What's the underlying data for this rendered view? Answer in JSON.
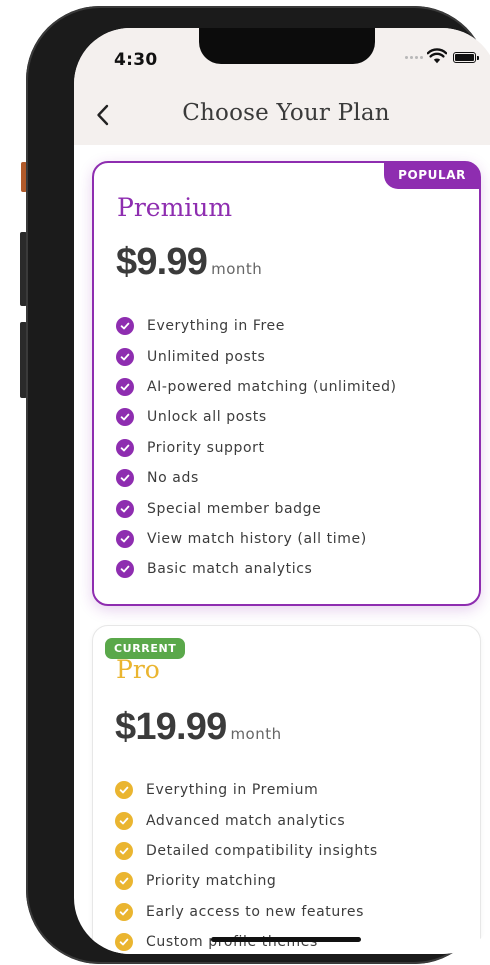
{
  "status_bar": {
    "time": "4:30"
  },
  "header": {
    "title": "Choose Your Plan"
  },
  "plans": [
    {
      "badge": "POPULAR",
      "name": "Premium",
      "price": "$9.99",
      "period": "month",
      "accent_color": "#8e2db0",
      "features": [
        "Everything in Free",
        "Unlimited posts",
        "AI-powered matching (unlimited)",
        "Unlock all posts",
        "Priority support",
        "No ads",
        "Special member badge",
        "View match history (all time)",
        "Basic match analytics"
      ]
    },
    {
      "badge": "CURRENT",
      "name": "Pro",
      "price": "$19.99",
      "period": "month",
      "accent_color": "#eab530",
      "badge_color": "#5aa84a",
      "features": [
        "Everything in Premium",
        "Advanced match analytics",
        "Detailed compatibility insights",
        "Priority matching",
        "Early access to new features",
        "Custom profile themes"
      ]
    }
  ],
  "icons": {
    "back": "chevron-left-icon",
    "check": "check-circle-icon",
    "wifi": "wifi-icon",
    "battery": "battery-icon"
  }
}
